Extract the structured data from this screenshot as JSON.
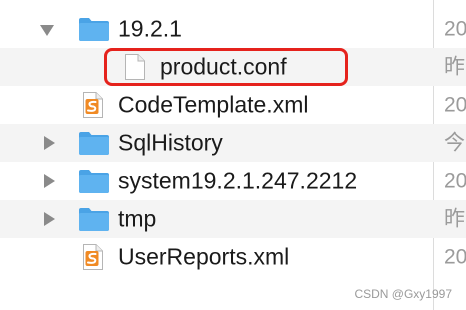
{
  "items": [
    {
      "name": "19.2.1",
      "date": "20",
      "type": "folder",
      "expanded": true
    },
    {
      "name": "product.conf",
      "date": "昨",
      "type": "file"
    },
    {
      "name": "CodeTemplate.xml",
      "date": "20",
      "type": "xml-file"
    },
    {
      "name": "SqlHistory",
      "date": "今",
      "type": "folder",
      "expanded": false
    },
    {
      "name": "system19.2.1.247.2212",
      "date": "20",
      "type": "folder",
      "expanded": false
    },
    {
      "name": "tmp",
      "date": "昨",
      "type": "folder",
      "expanded": false
    },
    {
      "name": "UserReports.xml",
      "date": "20",
      "type": "xml-file"
    }
  ],
  "watermark": "CSDN @Gxy1997",
  "colors": {
    "folder": "#5fb3f0",
    "folder_tab": "#4aa3e6",
    "highlight": "#e5221c",
    "xml_badge": "#f08a24",
    "disclosure": "#8a8a8a"
  }
}
